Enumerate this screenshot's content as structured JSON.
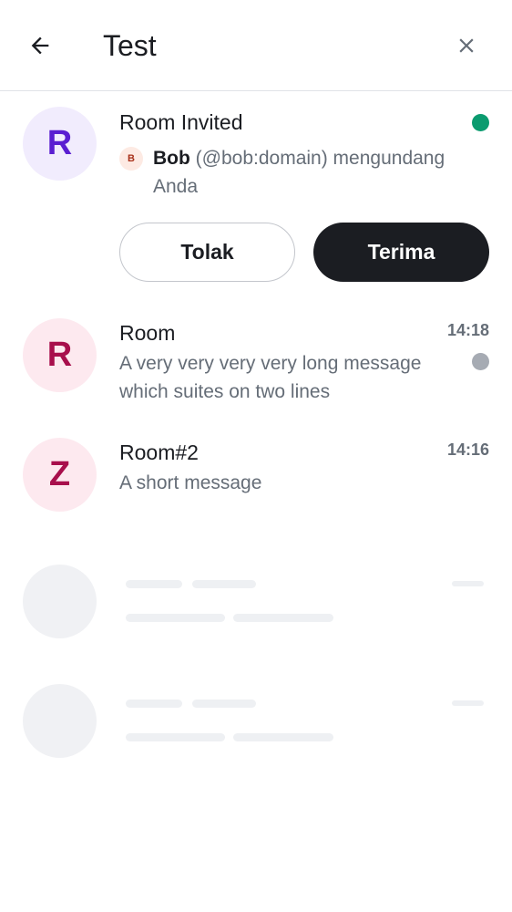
{
  "header": {
    "title": "Test",
    "back_icon": "arrow-left-icon",
    "close_icon": "close-icon"
  },
  "invite": {
    "avatar_letter": "R",
    "room_name": "Room Invited",
    "status_color": "#0b9b6f",
    "inviter_initial": "B",
    "inviter_name": "Bob",
    "invite_text": " (@bob:domain) mengundang Anda",
    "decline_label": "Tolak",
    "accept_label": "Terima"
  },
  "rooms": [
    {
      "avatar_letter": "R",
      "name": "Room",
      "time": "14:18",
      "message": "A very very very very long message which suites on two lines",
      "unread_dot_color": "#a6abb3"
    },
    {
      "avatar_letter": "Z",
      "name": "Room#2",
      "time": "14:16",
      "message": "A short message"
    }
  ],
  "colors": {
    "accent_purple": "#5a1ed1",
    "accent_pink": "#a80f4c",
    "primary_button": "#1b1d22"
  }
}
